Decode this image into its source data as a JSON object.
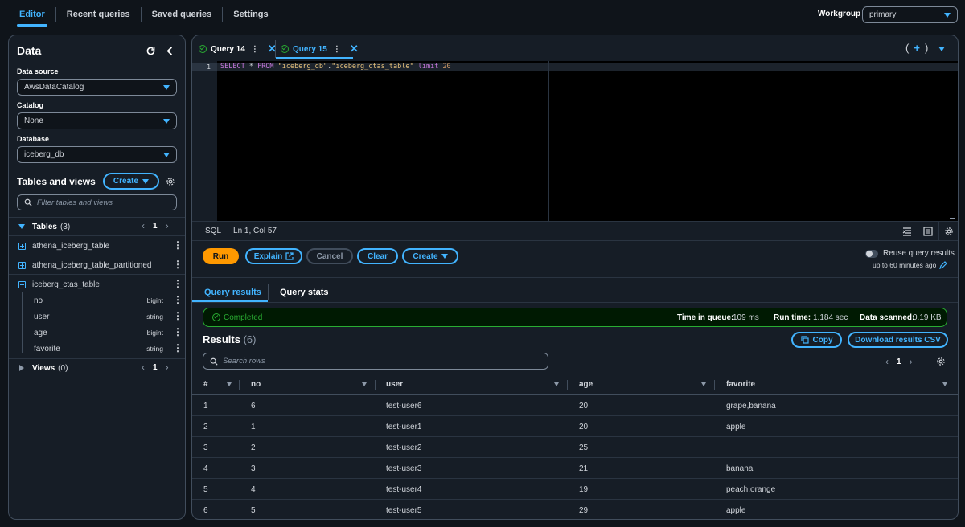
{
  "topnav": {
    "tabs": [
      {
        "label": "Editor"
      },
      {
        "label": "Recent queries"
      },
      {
        "label": "Saved queries"
      },
      {
        "label": "Settings"
      }
    ],
    "workgroup_label": "Workgroup",
    "workgroup_value": "primary"
  },
  "sidebar": {
    "title": "Data",
    "data_source_label": "Data source",
    "data_source_value": "AwsDataCatalog",
    "catalog_label": "Catalog",
    "catalog_value": "None",
    "database_label": "Database",
    "database_value": "iceberg_db",
    "tables_views_title": "Tables and views",
    "create_label": "Create",
    "filter_placeholder": "Filter tables and views",
    "tables_label": "Tables",
    "tables_count": "(3)",
    "tables_page": "1",
    "tables": [
      {
        "name": "athena_iceberg_table"
      },
      {
        "name": "athena_iceberg_table_partitioned"
      },
      {
        "name": "iceberg_ctas_table"
      }
    ],
    "columns": [
      {
        "name": "no",
        "type": "bigint"
      },
      {
        "name": "user",
        "type": "string"
      },
      {
        "name": "age",
        "type": "bigint"
      },
      {
        "name": "favorite",
        "type": "string"
      }
    ],
    "views_label": "Views",
    "views_count": "(0)",
    "views_page": "1"
  },
  "editor": {
    "tabs": [
      {
        "label": "Query 14",
        "active": false
      },
      {
        "label": "Query 15",
        "active": true
      }
    ],
    "line_number": "1",
    "sql": {
      "select": "SELECT",
      "star": " * ",
      "from": "FROM",
      "db": "\"iceberg_db\"",
      "dot": ".",
      "table": "\"iceberg_ctas_table\"",
      "limit": "limit",
      "limit_value": "20"
    },
    "language": "SQL",
    "cursor": "Ln 1, Col 57"
  },
  "actions": {
    "run": "Run",
    "explain": "Explain",
    "cancel": "Cancel",
    "clear": "Clear",
    "create": "Create",
    "reuse_label": "Reuse query results",
    "reuse_sub": "up to 60 minutes ago"
  },
  "results_tabs": [
    {
      "label": "Query results"
    },
    {
      "label": "Query stats"
    }
  ],
  "status": {
    "state": "Completed",
    "queue_label": "Time in queue:",
    "queue_value": "109 ms",
    "runtime_label": "Run time:",
    "runtime_value": "1.184 sec",
    "scanned_label": "Data scanned:",
    "scanned_value": "0.19 KB"
  },
  "results": {
    "title": "Results",
    "count": "(6)",
    "copy_label": "Copy",
    "download_label": "Download results CSV",
    "search_placeholder": "Search rows",
    "page": "1",
    "columns": [
      "#",
      "no",
      "user",
      "age",
      "favorite"
    ],
    "rows": [
      [
        "1",
        "6",
        "test-user6",
        "20",
        "grape,banana"
      ],
      [
        "2",
        "1",
        "test-user1",
        "20",
        "apple"
      ],
      [
        "3",
        "2",
        "test-user2",
        "25",
        ""
      ],
      [
        "4",
        "3",
        "test-user3",
        "21",
        "banana"
      ],
      [
        "5",
        "4",
        "test-user4",
        "19",
        "peach,orange"
      ],
      [
        "6",
        "5",
        "test-user5",
        "29",
        "apple"
      ]
    ]
  },
  "colors": {
    "accent": "#42b4ff",
    "run": "#ff9900",
    "success": "#29ad32",
    "background": "#0f141a",
    "panel": "#161d26"
  }
}
